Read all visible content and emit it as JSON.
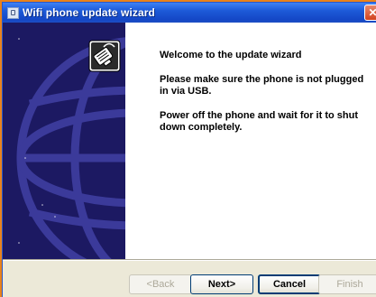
{
  "window": {
    "title": "Wifi phone update wizard",
    "close_symbol": "✕"
  },
  "content": {
    "heading": "Welcome to the update wizard",
    "paragraph1": "Please make sure the phone is not plugged in via USB.",
    "paragraph2": "Power off the phone and wait for it to shut down completely."
  },
  "buttons": {
    "back": {
      "label": "<Back",
      "enabled": false
    },
    "next": {
      "label": "Next>",
      "enabled": true
    },
    "cancel": {
      "label": "Cancel",
      "enabled": true,
      "focused": true
    },
    "finish": {
      "label": "Finish",
      "enabled": false
    }
  },
  "icons": {
    "window_icon": "app-icon",
    "banner_icon": "phone-cable-icon",
    "banner_background": "globe-graphic"
  },
  "colors": {
    "titlebar": "#1d5ad8",
    "banner": "#1c1962",
    "desktop": "#e9821c"
  }
}
